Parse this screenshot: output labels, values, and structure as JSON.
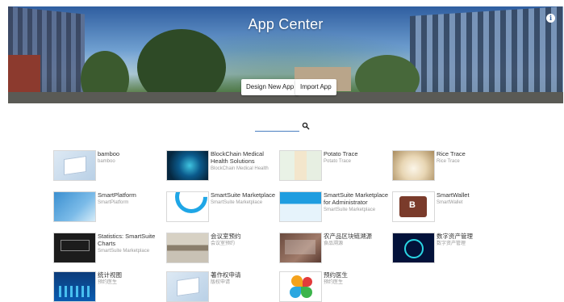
{
  "banner": {
    "title": "App Center",
    "design_label": "Design New App",
    "import_label": "Import App",
    "info_icon": "info-icon"
  },
  "search": {
    "placeholder": "",
    "icon": "search-icon"
  },
  "apps": [
    {
      "title": "bamboo",
      "sub": "bamboo"
    },
    {
      "title": "BlockChain Medical Health Solutions",
      "sub": "BlockChain Medical Health"
    },
    {
      "title": "Potato Trace",
      "sub": "Potato Trace"
    },
    {
      "title": "Rice Trace",
      "sub": "Rice Trace"
    },
    {
      "title": "SmartPlatform",
      "sub": "SmartPlatform"
    },
    {
      "title": "SmartSuite Marketplace",
      "sub": "SmartSuite Marketplace"
    },
    {
      "title": "SmartSuite Marketplace for Administrator",
      "sub": "SmartSuite Marketplace"
    },
    {
      "title": "SmartWallet",
      "sub": "SmartWallet"
    },
    {
      "title": "Statistics: SmartSuite Charts",
      "sub": "SmartSuite Marketplace"
    },
    {
      "title": "会议室预约",
      "sub": "会议室预约"
    },
    {
      "title": "农产品区块链溯源",
      "sub": "食品溯源"
    },
    {
      "title": "数字资产管理",
      "sub": "数字资产管理"
    },
    {
      "title": "统计视图",
      "sub": "预约医生"
    },
    {
      "title": "著作权申请",
      "sub": "版权申请"
    },
    {
      "title": "预约医生",
      "sub": "预约医生"
    }
  ]
}
